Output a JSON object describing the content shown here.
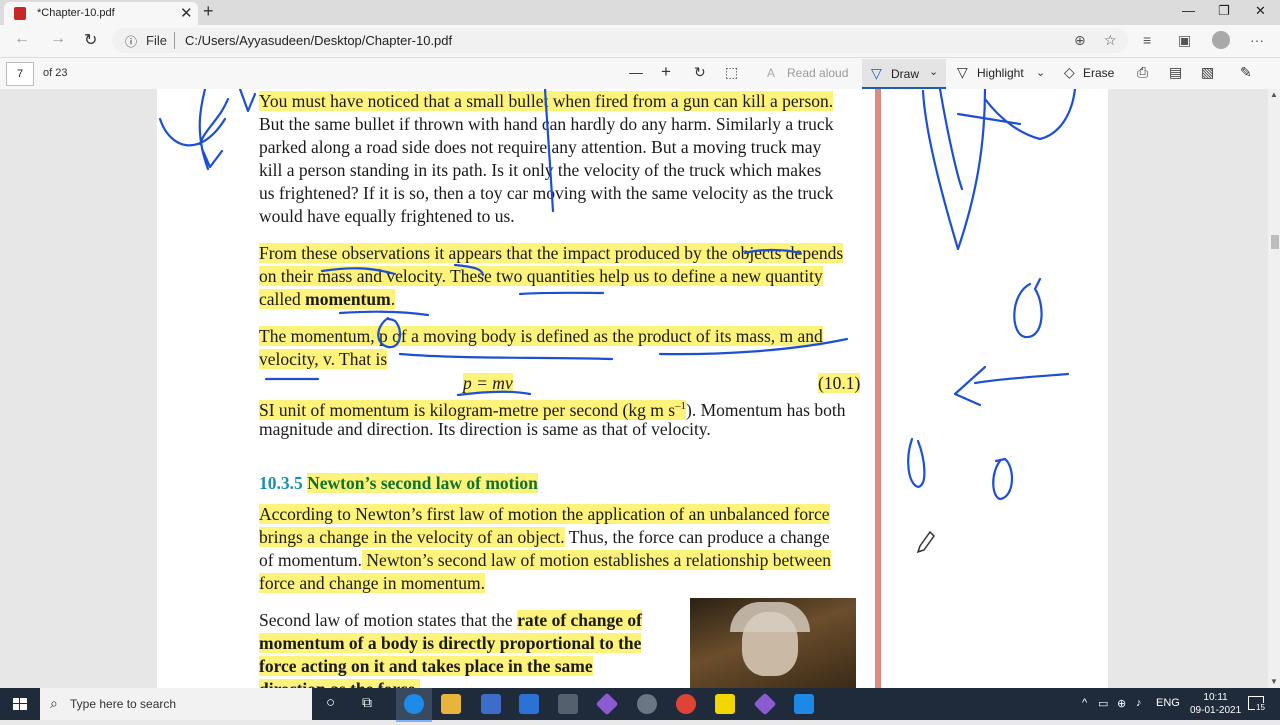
{
  "browser": {
    "tab_title": "*Chapter-10.pdf",
    "tab_close": "✕",
    "new_tab": "+",
    "address_scheme": "File",
    "address_url": "C:/Users/Ayyasudeen/Desktop/Chapter-10.pdf",
    "window_minimize": "—",
    "window_restore": "❐",
    "window_close": "✕"
  },
  "pdf_toolbar": {
    "page_number": "7",
    "page_total": "of 23",
    "read_aloud": "Read aloud",
    "draw": "Draw",
    "highlight": "Highlight",
    "erase": "Erase"
  },
  "document": {
    "para1": [
      "You must have noticed that a small bullet when fired from a gun can kill a person.",
      "But the same bullet if thrown with hand can hardly do any harm. Similarly a truck",
      "parked along a road side does not require any attention. But a moving truck may",
      "kill a person standing in its path. Is it only the velocity of the truck which makes",
      "us frightened? If it is so, then a toy car moving with the same velocity as the truck",
      "would have equally frightened to us."
    ],
    "para2": [
      "From these observations it appears that the impact produced by the objects depends",
      "on their mass and velocity. These two quantities help us to define a new quantity",
      "called "
    ],
    "para2_bold": "momentum",
    "para2_end": ".",
    "para3_line1": "The momentum, p of a moving body is defined as the product of its mass, m and",
    "para3_line2": "velocity, v. That is",
    "equation": "p = mv",
    "equation_number": "(10.1)",
    "unit_hl": "SI unit of momentum is kilogram-metre per second (kg m s",
    "unit_sup": "–1",
    "unit_rest": "). Momentum has both",
    "unit_line2": "magnitude and direction. Its direction is same as that of velocity.",
    "section_number": "10.3.5",
    "section_title": "Newton’s second law of motion",
    "para4": [
      "According to Newton’s first law of motion the application of an unbalanced force",
      "brings a change in the velocity of an object.",
      " Thus, the force can produce a change",
      "of momentum.",
      " Newton’s second law of motion establishes a relationship between",
      "force and change in momentum."
    ],
    "para5": [
      "Second law of motion states that the ",
      "rate of change of",
      "momentum of a body is directly proportional to the",
      "force acting on it and takes place in the same",
      "direction as the force."
    ]
  },
  "taskbar": {
    "search_placeholder": "Type here to search",
    "language": "ENG",
    "time": "10:11",
    "date": "09-01-2021",
    "notifications": "15"
  },
  "colors": {
    "highlight": "#fdf27a",
    "ink": "#1c4fd3",
    "margin_line": "#de8b86",
    "section_heading": "#1b8fb0"
  }
}
